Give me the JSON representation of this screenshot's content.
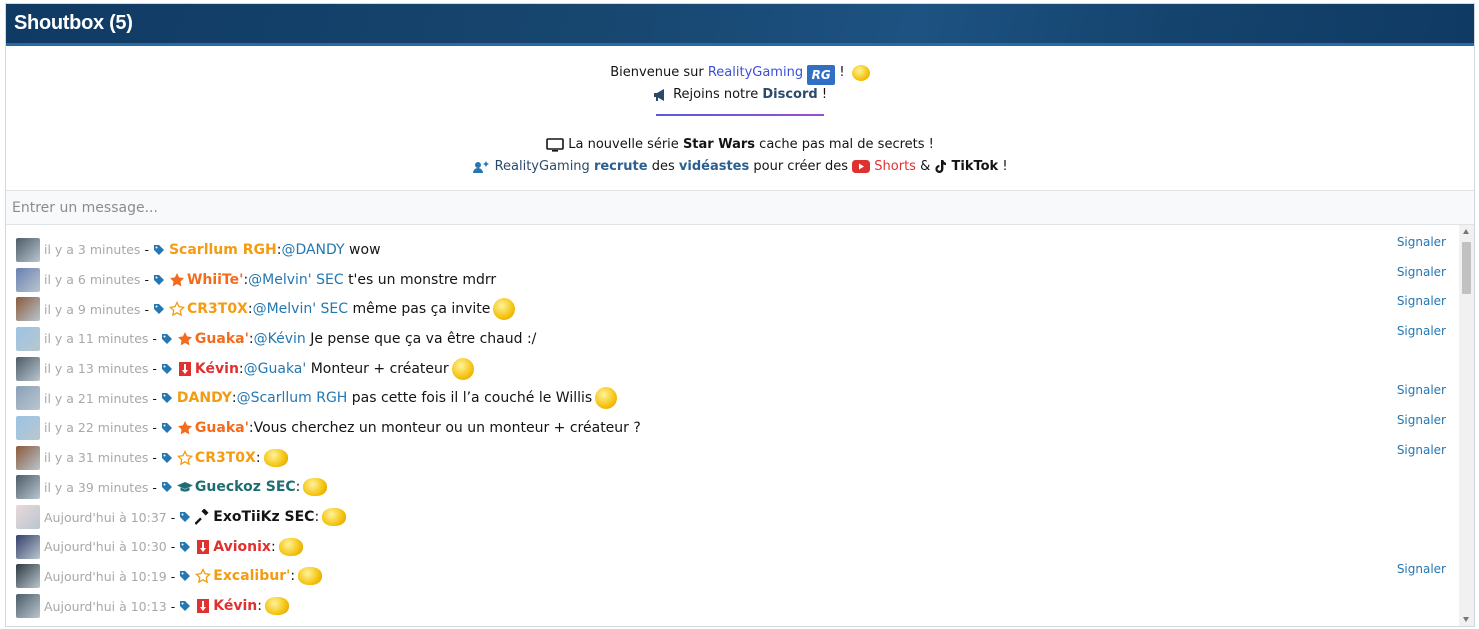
{
  "header": {
    "title": "Shoutbox (5)"
  },
  "motd": {
    "welcome_prefix": "Bienvenue sur",
    "welcome_brand": "RealityGaming",
    "welcome_suffix": "!",
    "rg_logo_text": "RG",
    "discord_prefix": "Rejoins notre",
    "discord_link": "Discord",
    "discord_suffix": "!",
    "starwars_prefix": "La nouvelle série",
    "starwars_bold": "Star Wars",
    "starwars_suffix": "cache pas mal de secrets !",
    "recruit_brand": "RealityGaming",
    "recruit_bold": "recrute",
    "recruit_mid": "des",
    "recruit_bold2": "vidéastes",
    "recruit_mid2": "pour créer des",
    "recruit_shorts": "Shorts",
    "recruit_amp": "&",
    "recruit_tiktok": "TikTok",
    "recruit_suffix": "!"
  },
  "input": {
    "placeholder": "Entrer un message..."
  },
  "report_label": "Signaler",
  "colors": {
    "orange": "#f39c12",
    "orange_red": "#f36b1c",
    "red": "#e03131",
    "teal": "#1c6e72",
    "black": "#141414",
    "link_blue": "#2577b1"
  },
  "messages": [
    {
      "time": "il y a 3 minutes",
      "user": "Scarllum RGH",
      "user_color": "#f39c12",
      "badge": "",
      "mention": "@DANDY",
      "text": "wow",
      "emoji": "",
      "report": true,
      "avatar": "#4b5c68"
    },
    {
      "time": "il y a 6 minutes",
      "user": "WhiiTe'",
      "user_color": "#f36b1c",
      "badge": "star-filled-icon",
      "mention": "@Melvin' SEC",
      "text": "t'es un monstre mdrr",
      "emoji": "",
      "report": true,
      "avatar": "#6a7fb0"
    },
    {
      "time": "il y a 9 minutes",
      "user": "CR3T0X",
      "user_color": "#f39c12",
      "badge": "star-outline-icon",
      "mention": "@Melvin' SEC",
      "text": "même pas ça invite",
      "emoji": "smirk-emoji",
      "report": true,
      "avatar": "#8a5a3c"
    },
    {
      "time": "il y a 11 minutes",
      "user": "Guaka'",
      "user_color": "#f36b1c",
      "badge": "star-filled-icon",
      "mention": "@Kévin",
      "text": "Je pense que ça va être chaud :/",
      "emoji": "",
      "report": true,
      "avatar": "#9bc4e4"
    },
    {
      "time": "il y a 13 minutes",
      "user": "Kévin",
      "user_color": "#e03131",
      "badge": "red-badge-icon",
      "mention": "@Guaka'",
      "text": "Monteur + créateur",
      "emoji": "wink-emoji",
      "report": false,
      "avatar": "#4b5c68"
    },
    {
      "time": "il y a 21 minutes",
      "user": "DANDY",
      "user_color": "#f39c12",
      "badge": "",
      "mention": "@Scarllum RGH",
      "text": "pas cette fois il l’a couché le Willis",
      "emoji": "shocked-emoji",
      "report": true,
      "avatar": "#8aa0b8"
    },
    {
      "time": "il y a 22 minutes",
      "user": "Guaka'",
      "user_color": "#f36b1c",
      "badge": "star-filled-icon",
      "mention": "",
      "text": "Vous cherchez un monteur ou un monteur + créateur ?",
      "emoji": "",
      "report": true,
      "avatar": "#9bc4e4"
    },
    {
      "time": "il y a 31 minutes",
      "user": "CR3T0X",
      "user_color": "#f39c12",
      "badge": "star-outline-icon",
      "mention": "",
      "text": "",
      "emoji": "binoculars-emoji",
      "report": true,
      "avatar": "#8a5a3c"
    },
    {
      "time": "il y a 39 minutes",
      "user": "Gueckoz SEC",
      "user_color": "#1c6e72",
      "badge": "graduation-cap-icon",
      "mention": "",
      "text": "",
      "emoji": "binoculars-emoji",
      "report": false,
      "avatar": "#4b5c68"
    },
    {
      "time": "Aujourd'hui à 10:37",
      "user": "ExoTiiKz SEC",
      "user_color": "#141414",
      "badge": "gavel-icon",
      "mention": "",
      "text": "",
      "emoji": "binoculars-emoji",
      "report": false,
      "avatar": "#e9d9d9"
    },
    {
      "time": "Aujourd'hui à 10:30",
      "user": "Avionix",
      "user_color": "#e03131",
      "badge": "red-badge-icon",
      "mention": "",
      "text": "",
      "emoji": "binoculars-emoji",
      "report": false,
      "avatar": "#33406a"
    },
    {
      "time": "Aujourd'hui à 10:19",
      "user": "Excalibur'",
      "user_color": "#f39c12",
      "badge": "star-outline-icon",
      "mention": "",
      "text": "",
      "emoji": "binoculars-emoji",
      "report": true,
      "avatar": "#2e3a40"
    },
    {
      "time": "Aujourd'hui à 10:13",
      "user": "Kévin",
      "user_color": "#e03131",
      "badge": "red-badge-icon",
      "mention": "",
      "text": "",
      "emoji": "binoculars-emoji",
      "report": false,
      "avatar": "#4b5c68"
    }
  ]
}
